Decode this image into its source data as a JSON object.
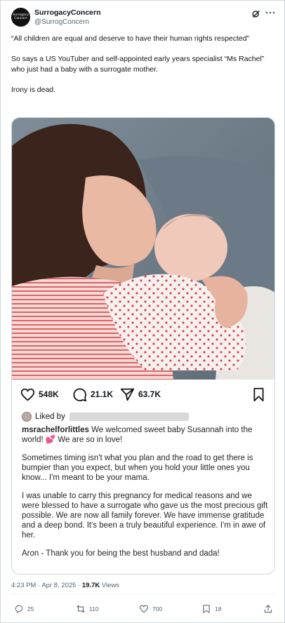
{
  "author": {
    "name": "SurrogacyConcern",
    "handle": "@SurrogConcern",
    "avatar_text": "Surrogacy Concern"
  },
  "tweet": {
    "paragraphs": [
      "“All children are equal and deserve to have their human rights respected”",
      "So says a US YouTuber and self-appointed early years specialist “Ms Rachel” who just had a baby with a surrogate mother.",
      "Irony is dead."
    ]
  },
  "embed": {
    "likes": "548K",
    "comments": "21.1K",
    "shares": "63.7K",
    "liked_by_label": "Liked by",
    "caption_user": "msrachelforlittles",
    "caption_paragraphs": [
      "We welcomed sweet baby Susannah into the world! 💕 We are so in love!",
      "Sometimes timing isn't what you plan and the road to get there is bumpier than you expect, but when you hold your little ones you know... I'm meant to be your mama.",
      "I was unable to carry this pregnancy for medical reasons and we were blessed to have a surrogate who gave us the most precious gift possible. We are now all family forever. We have immense gratitude and a deep bond. It's been a truly beautiful experience. I'm in awe of her.",
      "Aron - Thank you for being the best husband and dada!"
    ]
  },
  "meta": {
    "time": "4:23 PM",
    "sep1": " · ",
    "date": "Apr 8, 2025",
    "sep2": " · ",
    "views_count": "19.7K",
    "views_label": " Views"
  },
  "actions": {
    "replies": "25",
    "reposts": "110",
    "likes": "700",
    "bookmarks": "18"
  }
}
